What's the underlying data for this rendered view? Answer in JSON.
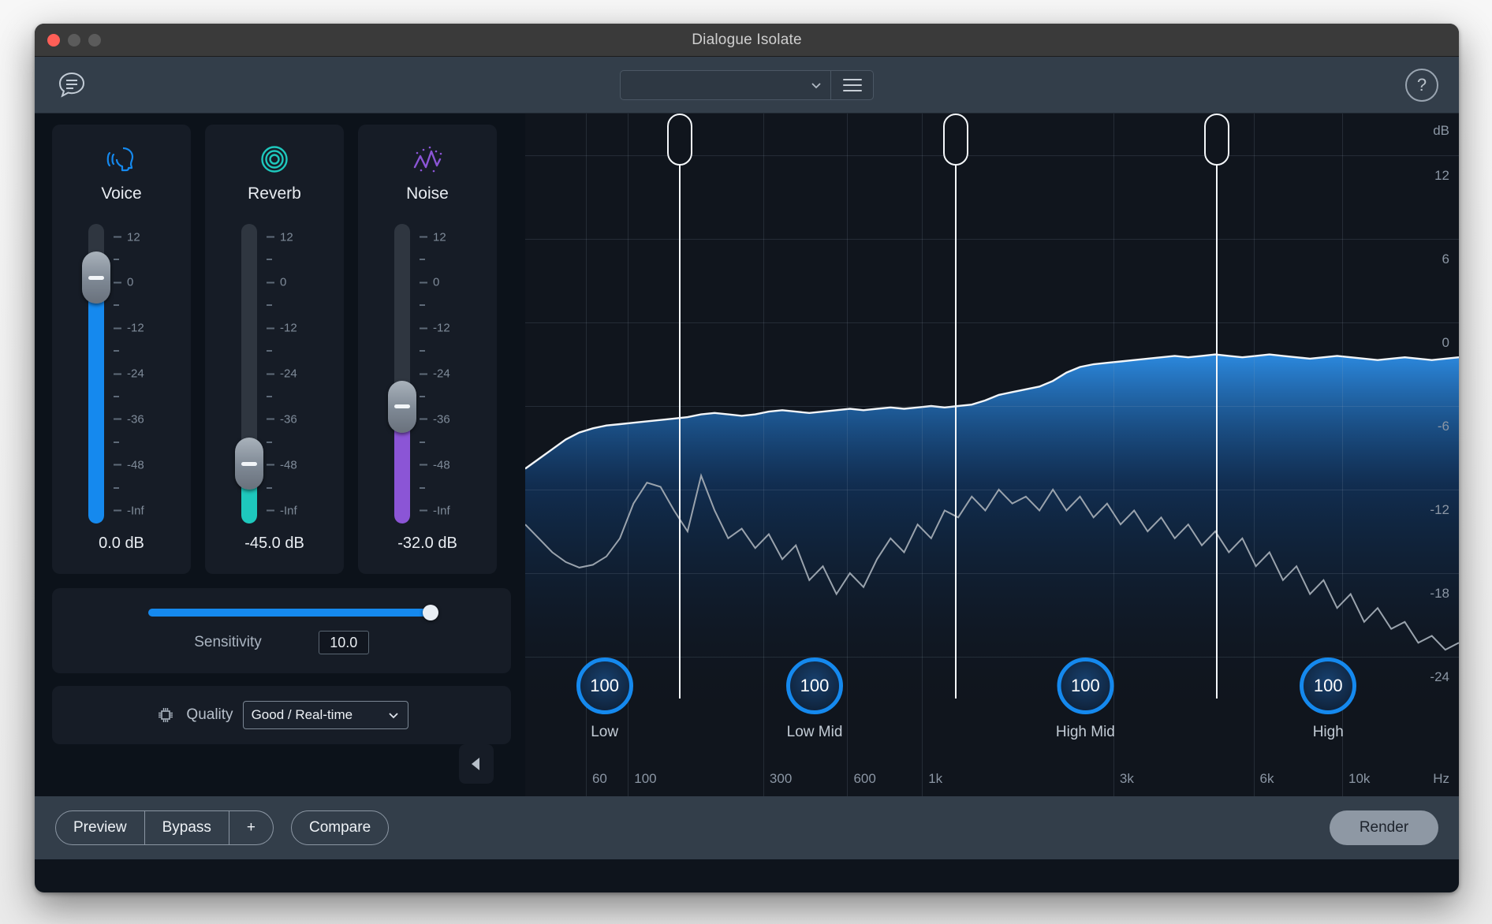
{
  "window": {
    "title": "Dialogue Isolate",
    "traffic_lights": [
      "close",
      "minimize",
      "maximize"
    ]
  },
  "header": {
    "comment_icon": "speech-bubble-icon",
    "preset": {
      "value": "",
      "placeholder": ""
    },
    "menu_icon": "hamburger-menu-icon",
    "help_label": "?"
  },
  "modules": [
    {
      "name": "Voice",
      "icon": "voice-head-icon",
      "color": "#1589ee",
      "value": "0.0 dB",
      "fill_percent": 82,
      "thumb_percent": 82,
      "scale": [
        "12",
        "0",
        "-12",
        "-24",
        "-36",
        "-48",
        "-Inf"
      ]
    },
    {
      "name": "Reverb",
      "icon": "reverb-rings-icon",
      "color": "#1ec8bd",
      "value": "-45.0 dB",
      "fill_percent": 20,
      "thumb_percent": 20,
      "scale": [
        "12",
        "0",
        "-12",
        "-24",
        "-36",
        "-48",
        "-Inf"
      ]
    },
    {
      "name": "Noise",
      "icon": "noise-waveform-icon",
      "color": "#8b55d6",
      "value": "-32.0 dB",
      "fill_percent": 39,
      "thumb_percent": 39,
      "scale": [
        "12",
        "0",
        "-12",
        "-24",
        "-36",
        "-48",
        "-Inf"
      ]
    }
  ],
  "sensitivity": {
    "label": "Sensitivity",
    "value": "10.0",
    "fill_percent": 100
  },
  "quality": {
    "icon": "chip-icon",
    "label": "Quality",
    "value": "Good / Real-time",
    "chevron": "chevron-down-icon",
    "collapse_icon": "collapse-left-icon"
  },
  "chart_data": {
    "type": "line",
    "title": "",
    "xlabel": "Hz",
    "ylabel": "dB",
    "grid": true,
    "x_ticks": [
      "60",
      "100",
      "300",
      "600",
      "1k",
      "3k",
      "6k",
      "10k"
    ],
    "x_tick_positions": [
      6.5,
      11.0,
      25.5,
      34.5,
      42.5,
      63.0,
      78.0,
      87.5
    ],
    "y_ticks": [
      "12",
      "6",
      "0",
      "-6",
      "-12",
      "-18",
      "-24"
    ],
    "ylim": [
      -27,
      15
    ],
    "series": [
      {
        "name": "output-spectrum",
        "color": "#f2f5f8",
        "values": [
          -10.5,
          -9.8,
          -9.1,
          -8.4,
          -7.9,
          -7.6,
          -7.4,
          -7.3,
          -7.2,
          -7.1,
          -7.0,
          -6.9,
          -6.8,
          -6.6,
          -6.5,
          -6.6,
          -6.7,
          -6.6,
          -6.4,
          -6.3,
          -6.4,
          -6.5,
          -6.4,
          -6.3,
          -6.2,
          -6.3,
          -6.2,
          -6.1,
          -6.2,
          -6.1,
          -6.0,
          -6.1,
          -6.0,
          -5.9,
          -5.6,
          -5.2,
          -5.0,
          -4.8,
          -4.6,
          -4.2,
          -3.6,
          -3.2,
          -3.0,
          -2.9,
          -2.8,
          -2.7,
          -2.6,
          -2.5,
          -2.4,
          -2.5,
          -2.4,
          -2.3,
          -2.4,
          -2.5,
          -2.4,
          -2.3,
          -2.4,
          -2.5,
          -2.6,
          -2.5,
          -2.4,
          -2.5,
          -2.6,
          -2.7,
          -2.6,
          -2.5,
          -2.6,
          -2.7,
          -2.6,
          -2.5
        ]
      },
      {
        "name": "input-spectrum",
        "color": "#9aa3ad",
        "values": [
          -14.5,
          -15.5,
          -16.5,
          -17.2,
          -17.6,
          -17.4,
          -16.8,
          -15.5,
          -13.0,
          -11.5,
          -11.8,
          -13.5,
          -15.0,
          -11.0,
          -13.5,
          -15.5,
          -14.8,
          -16.2,
          -15.2,
          -17.0,
          -16.0,
          -18.5,
          -17.5,
          -19.5,
          -18.0,
          -19.0,
          -17.0,
          -15.5,
          -16.5,
          -14.5,
          -15.5,
          -13.5,
          -14.0,
          -12.5,
          -13.5,
          -12.0,
          -13.0,
          -12.5,
          -13.5,
          -12.0,
          -13.5,
          -12.5,
          -14.0,
          -13.0,
          -14.5,
          -13.5,
          -15.0,
          -14.0,
          -15.5,
          -14.5,
          -16.0,
          -15.0,
          -16.5,
          -15.5,
          -17.5,
          -16.5,
          -18.5,
          -17.5,
          -19.5,
          -18.5,
          -20.5,
          -19.5,
          -21.5,
          -20.5,
          -22.0,
          -21.5,
          -23.0,
          -22.5,
          -23.5,
          -23.0
        ]
      }
    ],
    "crossover_positions": [
      16.5,
      46.0,
      74.0
    ],
    "bands": [
      {
        "label": "Low",
        "value": "100",
        "x_percent": 8.5
      },
      {
        "label": "Low Mid",
        "value": "100",
        "x_percent": 31.0
      },
      {
        "label": "High Mid",
        "value": "100",
        "x_percent": 60.0
      },
      {
        "label": "High",
        "value": "100",
        "x_percent": 86.0
      }
    ]
  },
  "footer": {
    "preview_label": "Preview",
    "bypass_label": "Bypass",
    "plus_label": "+",
    "compare_label": "Compare",
    "render_label": "Render"
  }
}
